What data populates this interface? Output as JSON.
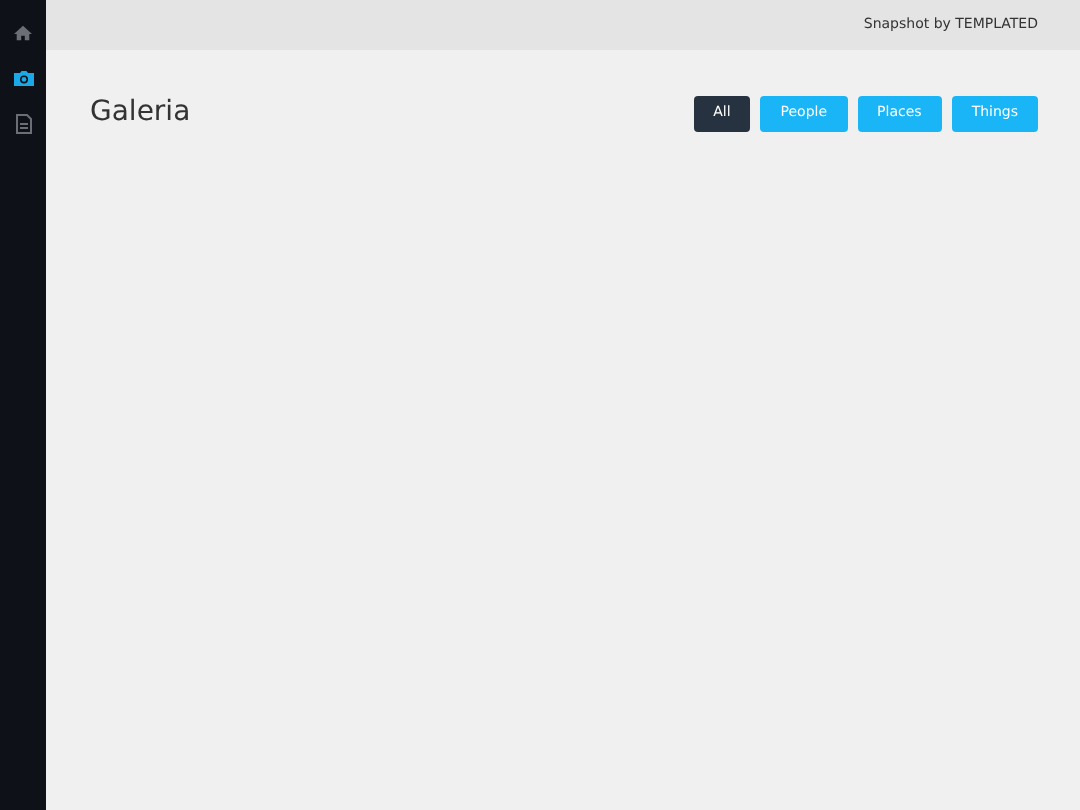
{
  "sidebar": {
    "items": [
      {
        "kind": "home",
        "selected": false
      },
      {
        "kind": "camera",
        "selected": true
      },
      {
        "kind": "document",
        "selected": false
      }
    ]
  },
  "header": {
    "text": "Snapshot by TEMPLATED"
  },
  "page": {
    "title": "Galeria"
  },
  "filters": [
    {
      "label": "All",
      "selected": true
    },
    {
      "label": "People",
      "selected": false
    },
    {
      "label": "Places",
      "selected": false
    },
    {
      "label": "Things",
      "selected": false
    }
  ]
}
